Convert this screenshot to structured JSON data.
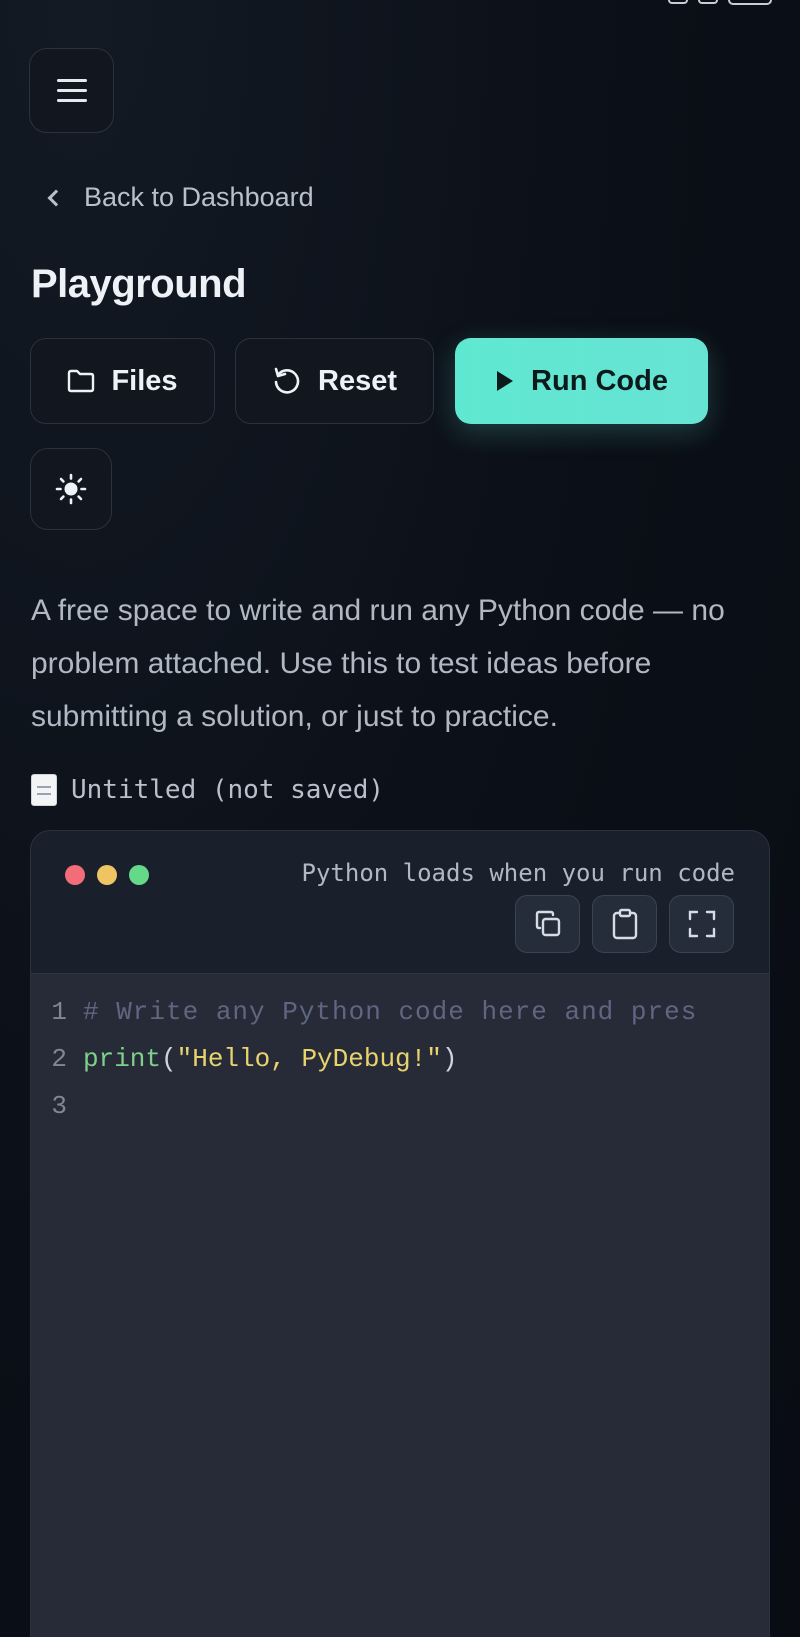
{
  "header": {
    "back_label": "Back to Dashboard",
    "title": "Playground"
  },
  "toolbar": {
    "files_label": "Files",
    "reset_label": "Reset",
    "run_label": "Run Code",
    "theme_icon": "sun-icon"
  },
  "description": "A free space to write and run any Python code — no problem attached. Use this to test ideas before submitting a solution, or just to practice.",
  "file": {
    "name": "Untitled (not saved)"
  },
  "editor": {
    "hint": "Python loads when you run code",
    "tools": [
      "copy-icon",
      "paste-icon",
      "fullscreen-icon"
    ],
    "lines": [
      {
        "number": "1",
        "text": "# Write any Python code here and pres"
      },
      {
        "number": "2",
        "func": "print",
        "open": "(",
        "string": "\"Hello, PyDebug!\"",
        "close": ")"
      },
      {
        "number": "3",
        "text": ""
      }
    ]
  },
  "colors": {
    "accent": "#5fe8d1",
    "background": "#0b0f17",
    "editor_bg": "#272b38",
    "dot_red": "#f26d78",
    "dot_yellow": "#efc463",
    "dot_green": "#64d98a"
  }
}
